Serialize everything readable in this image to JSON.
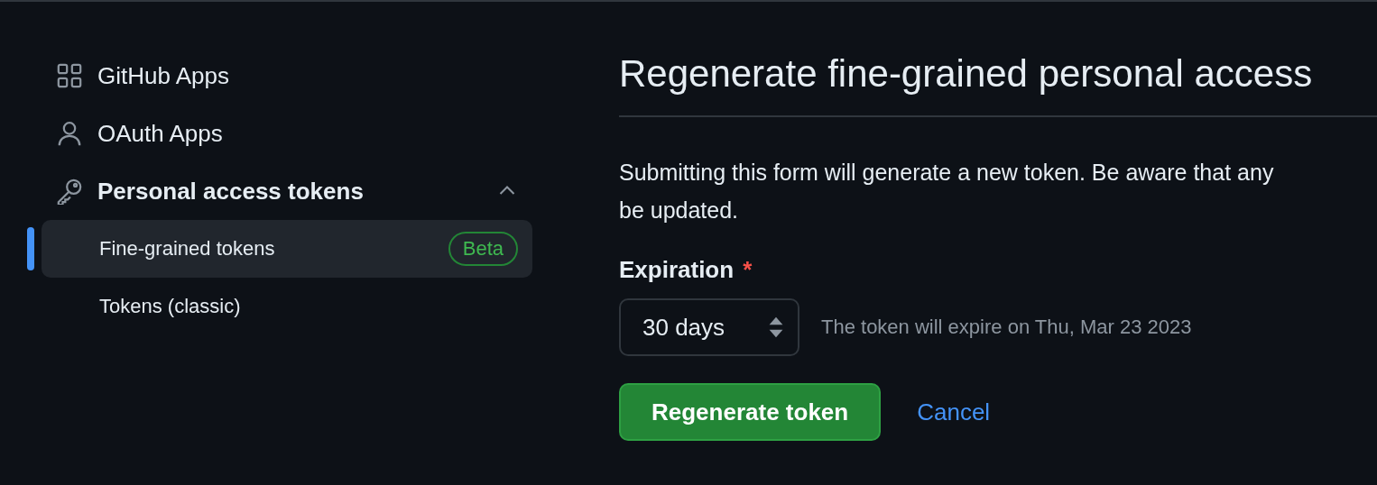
{
  "sidebar": {
    "items": [
      {
        "kind": "link",
        "label": "GitHub Apps",
        "selected": false
      },
      {
        "kind": "link",
        "label": "OAuth Apps",
        "selected": false
      },
      {
        "kind": "group",
        "label": "Personal access tokens",
        "expanded": true,
        "children": [
          {
            "label": "Fine-grained tokens",
            "badge": "Beta",
            "selected": true
          },
          {
            "label": "Tokens (classic)",
            "selected": false
          }
        ]
      }
    ]
  },
  "main": {
    "heading": "Regenerate fine-grained personal access",
    "description": [
      "Submitting this form will generate a new token. Be aware that any",
      "be updated."
    ],
    "expiration": {
      "label": "Expiration",
      "required_mark": "*",
      "value": "30 days",
      "hint": "The token will expire on Thu, Mar 23 2023"
    },
    "buttons": [
      {
        "kind": "primary",
        "label": "Regenerate token"
      },
      {
        "kind": "link",
        "label": "Cancel"
      }
    ]
  }
}
